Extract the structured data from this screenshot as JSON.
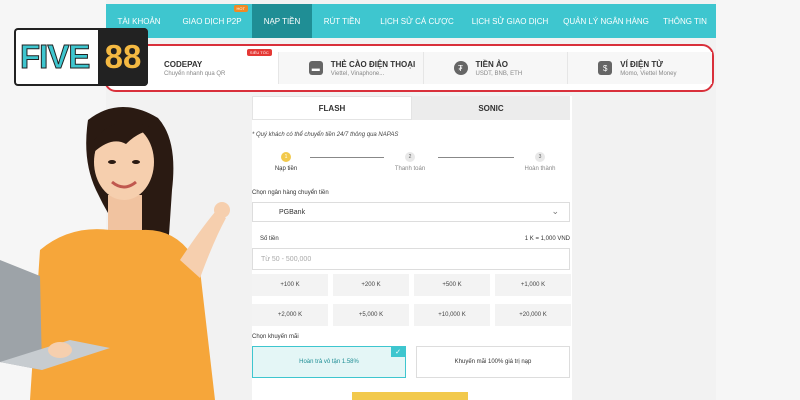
{
  "logo": {
    "text_left": "FIVE",
    "text_right": "88"
  },
  "nav": {
    "tabs": [
      {
        "label": "TÀI KHOẢN"
      },
      {
        "label": "GIAO DỊCH P2P",
        "badge": "HOT"
      },
      {
        "label": "NẠP TIỀN"
      },
      {
        "label": "RÚT TIỀN"
      },
      {
        "label": "LỊCH SỬ CÁ CƯỢC"
      },
      {
        "label": "LỊCH SỬ GIAO DỊCH"
      },
      {
        "label": "QUẢN LÝ NGÂN HÀNG"
      },
      {
        "label": "THÔNG TIN"
      }
    ],
    "active_index": 2
  },
  "methods": [
    {
      "title": "CODEPAY",
      "sub": "Chuyển nhanh qua QR",
      "badge": "SIÊU TỐC",
      "icon": "qr-icon"
    },
    {
      "title": "THẺ CÀO ĐIỆN THOẠI",
      "sub": "Viettel, Vinaphone...",
      "icon": "card-icon"
    },
    {
      "title": "TIỀN ẢO",
      "sub": "USDT, BNB, ETH",
      "icon": "tether-icon"
    },
    {
      "title": "VÍ ĐIỆN TỬ",
      "sub": "Momo, Viettel Money",
      "icon": "wallet-icon"
    }
  ],
  "segments": {
    "left": "FLASH",
    "right": "SONIC"
  },
  "note": "* Quý khách có thể chuyển tiền 24/7 thông qua NAPAS",
  "steps": [
    {
      "num": "1",
      "label": "Nạp tiền"
    },
    {
      "num": "2",
      "label": "Thanh toán"
    },
    {
      "num": "3",
      "label": "Hoàn thành"
    }
  ],
  "bank": {
    "label": "Chọn ngân hàng chuyển tiền",
    "value": "PGBank"
  },
  "amount": {
    "label": "Số tiền",
    "rate": "1 K = 1,000 VND",
    "placeholder": "Từ 50 - 500,000"
  },
  "quick_amounts": [
    "+100 K",
    "+200 K",
    "+500 K",
    "+1,000 K",
    "+2,000 K",
    "+5,000 K",
    "+10,000 K",
    "+20,000 K"
  ],
  "promo": {
    "label": "Chọn khuyến mãi",
    "options": [
      "Hoàn trả vô tận 1.58%",
      "Khuyến mãi 100% giá trị nạp"
    ]
  },
  "colors": {
    "teal": "#3ec6cf",
    "teal_dark": "#1f8e95",
    "highlight": "#d9303b",
    "yellow": "#f2c94c"
  }
}
